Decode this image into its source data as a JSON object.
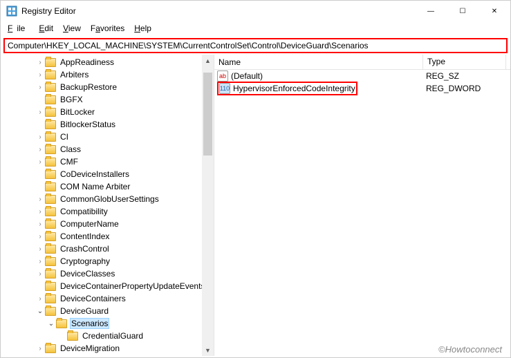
{
  "window": {
    "title": "Registry Editor",
    "min_icon": "—",
    "max_icon": "☐",
    "close_icon": "✕"
  },
  "menu": {
    "file": "File",
    "edit": "Edit",
    "view": "View",
    "favorites": "Favorites",
    "help": "Help"
  },
  "address": "Computer\\HKEY_LOCAL_MACHINE\\SYSTEM\\CurrentControlSet\\Control\\DeviceGuard\\Scenarios",
  "tree": {
    "items": [
      {
        "label": "AppReadiness",
        "depth": 3,
        "exp": "closed"
      },
      {
        "label": "Arbiters",
        "depth": 3,
        "exp": "closed"
      },
      {
        "label": "BackupRestore",
        "depth": 3,
        "exp": "closed"
      },
      {
        "label": "BGFX",
        "depth": 3,
        "exp": "none"
      },
      {
        "label": "BitLocker",
        "depth": 3,
        "exp": "closed"
      },
      {
        "label": "BitlockerStatus",
        "depth": 3,
        "exp": "none"
      },
      {
        "label": "CI",
        "depth": 3,
        "exp": "closed"
      },
      {
        "label": "Class",
        "depth": 3,
        "exp": "closed"
      },
      {
        "label": "CMF",
        "depth": 3,
        "exp": "closed"
      },
      {
        "label": "CoDeviceInstallers",
        "depth": 3,
        "exp": "none"
      },
      {
        "label": "COM Name Arbiter",
        "depth": 3,
        "exp": "none"
      },
      {
        "label": "CommonGlobUserSettings",
        "depth": 3,
        "exp": "closed"
      },
      {
        "label": "Compatibility",
        "depth": 3,
        "exp": "closed"
      },
      {
        "label": "ComputerName",
        "depth": 3,
        "exp": "closed"
      },
      {
        "label": "ContentIndex",
        "depth": 3,
        "exp": "closed"
      },
      {
        "label": "CrashControl",
        "depth": 3,
        "exp": "closed"
      },
      {
        "label": "Cryptography",
        "depth": 3,
        "exp": "closed"
      },
      {
        "label": "DeviceClasses",
        "depth": 3,
        "exp": "closed"
      },
      {
        "label": "DeviceContainerPropertyUpdateEvents",
        "depth": 3,
        "exp": "none"
      },
      {
        "label": "DeviceContainers",
        "depth": 3,
        "exp": "closed"
      },
      {
        "label": "DeviceGuard",
        "depth": 3,
        "exp": "open"
      },
      {
        "label": "Scenarios",
        "depth": 4,
        "exp": "open",
        "selected": true
      },
      {
        "label": "CredentialGuard",
        "depth": 5,
        "exp": "none"
      },
      {
        "label": "DeviceMigration",
        "depth": 3,
        "exp": "closed"
      }
    ]
  },
  "list": {
    "headers": {
      "name": "Name",
      "type": "Type"
    },
    "rows": [
      {
        "icon": "str",
        "name": "(Default)",
        "type": "REG_SZ",
        "hl": false
      },
      {
        "icon": "num",
        "name": "HypervisorEnforcedCodeIntegrity",
        "type": "REG_DWORD",
        "hl": true
      }
    ]
  },
  "watermark": "©Howtoconnect",
  "icons": {
    "str_glyph": "ab",
    "num_glyph": "110"
  }
}
